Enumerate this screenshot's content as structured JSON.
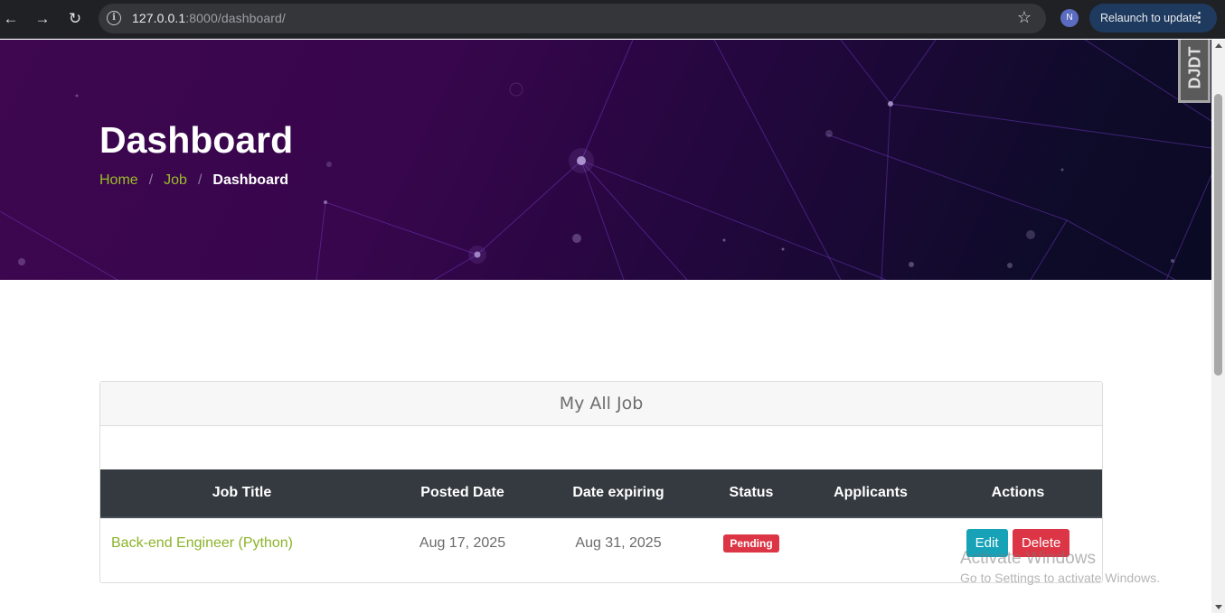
{
  "browser": {
    "url_host": "127.0.0.1",
    "url_rest": ":8000/dashboard/",
    "profile_initial": "N",
    "relaunch_label": "Relaunch to update"
  },
  "hero": {
    "title": "Dashboard",
    "breadcrumb": [
      "Home",
      "Job",
      "Dashboard"
    ],
    "separator": "/",
    "debug_toolbar_label": "DJDT"
  },
  "card": {
    "header": "My All Job",
    "columns": [
      "Job Title",
      "Posted Date",
      "Date expiring",
      "Status",
      "Applicants",
      "Actions"
    ],
    "rows": [
      {
        "title": "Back-end Engineer (Python)",
        "posted": "Aug 17, 2025",
        "expiring": "Aug 31, 2025",
        "status": "Pending",
        "applicants": "",
        "edit": "Edit",
        "delete": "Delete"
      }
    ]
  },
  "watermark": {
    "line1": "Activate Windows",
    "line2": "Go to Settings to activate Windows."
  },
  "colors": {
    "accent_green": "#8cb32a",
    "status_pending": "#dc3545",
    "edit_button": "#17a2b8",
    "table_header": "#343a40"
  }
}
